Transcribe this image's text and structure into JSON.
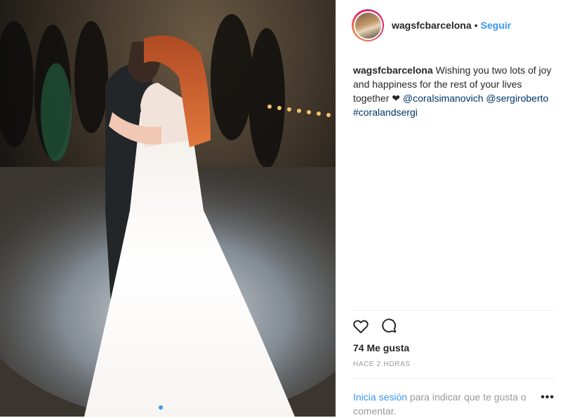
{
  "post": {
    "username": "wagsfcbarcelona",
    "separator": "•",
    "follow_label": "Seguir",
    "caption": {
      "username": "wagsfcbarcelona",
      "text": "Wishing you two lots of joy and happiness for the rest of your lives together",
      "heart": "❤",
      "mentions": [
        "@coralsimanovich",
        "@sergiroberto"
      ],
      "hashtag": "#coralandsergi"
    },
    "likes": "74 Me gusta",
    "timestamp": "HACE 2 HORAS",
    "login_link": "Inicia sesión",
    "login_text": " para indicar que te gusta o comentar.",
    "more": "•••",
    "carousel": {
      "count": 3,
      "active": 0
    },
    "icons": {
      "like": "heart-outline-icon",
      "comment": "comment-bubble-icon",
      "more": "more-options-icon"
    },
    "colors": {
      "link": "#3897f0",
      "mention": "#003569",
      "text": "#262626",
      "muted": "#999999"
    }
  }
}
